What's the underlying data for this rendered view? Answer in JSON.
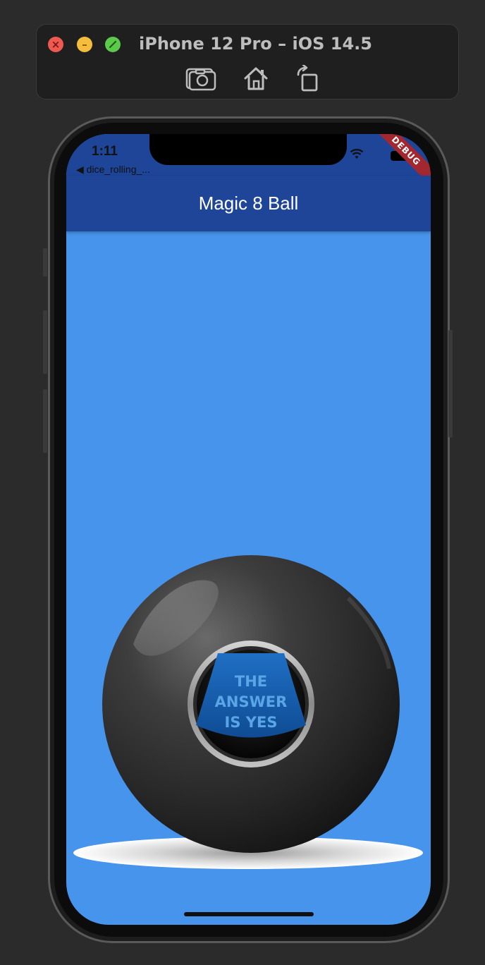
{
  "simulator": {
    "title": "iPhone 12 Pro – iOS 14.5",
    "controls": {
      "close": "close-icon",
      "minimize": "minimize-icon",
      "zoom": "zoom-icon"
    },
    "toolbar_icons": [
      "camera-icon",
      "home-icon",
      "rotate-icon"
    ]
  },
  "status_bar": {
    "time": "1:11",
    "back_label": "◀ dice_rolling_..."
  },
  "debug_banner": "DEBUG",
  "app_bar": {
    "title": "Magic 8 Ball",
    "color": "#1f4598"
  },
  "body": {
    "background_color": "#4694eb",
    "ball_answer_lines": [
      "THE",
      "ANSWER",
      "IS YES"
    ]
  }
}
